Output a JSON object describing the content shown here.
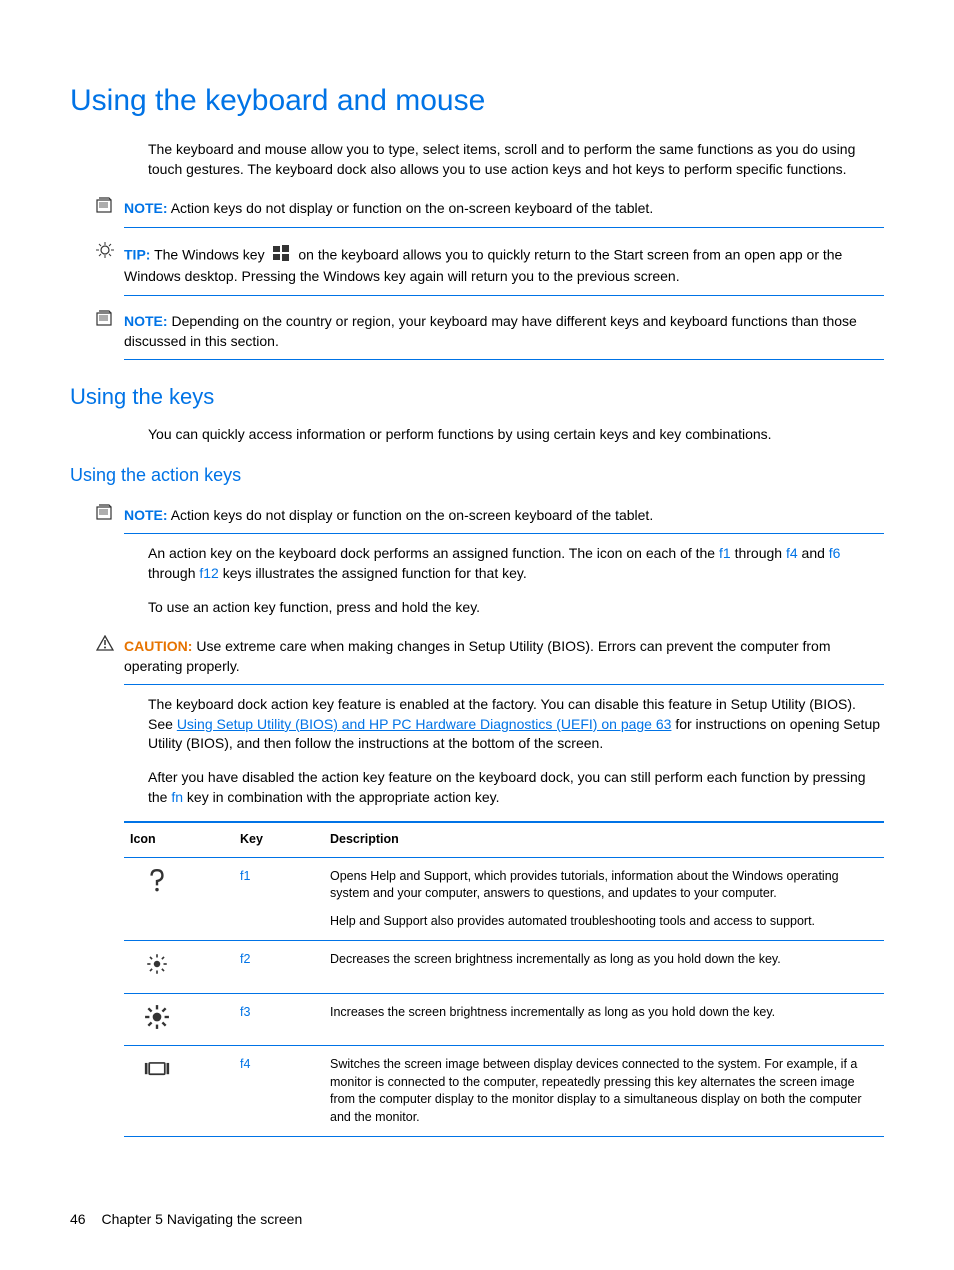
{
  "h1": "Using the keyboard and mouse",
  "intro": "The keyboard and mouse allow you to type, select items, scroll and to perform the same functions as you do using touch gestures. The keyboard dock also allows you to use action keys and hot keys to perform specific functions.",
  "note1_label": "NOTE:",
  "note1_text": "Action keys do not display or function on the on-screen keyboard of the tablet.",
  "tip_label": "TIP:",
  "tip_text_before": "The Windows key",
  "tip_text_after": "on the keyboard allows you to quickly return to the Start screen from an open app or the Windows desktop. Pressing the Windows key again will return you to the previous screen.",
  "note2_label": "NOTE:",
  "note2_text": "Depending on the country or region, your keyboard may have different keys and keyboard functions than those discussed in this section.",
  "h2": "Using the keys",
  "keys_intro": "You can quickly access information or perform functions by using certain keys and key combinations.",
  "h3": "Using the action keys",
  "note3_label": "NOTE:",
  "note3_text": "Action keys do not display or function on the on-screen keyboard of the tablet.",
  "action_p1_a": "An action key on the keyboard dock performs an assigned function. The icon on each of the ",
  "key_f1": "f1",
  "action_p1_b": " through ",
  "key_f4": "f4",
  "action_p1_c": " and ",
  "key_f6": "f6",
  "action_p1_d": " through ",
  "key_f12": "f12",
  "action_p1_e": " keys illustrates the assigned function for that key.",
  "action_p2": "To use an action key function, press and hold the key.",
  "caution_label": "CAUTION:",
  "caution_text": "Use extreme care when making changes in Setup Utility (BIOS). Errors can prevent the computer from operating properly.",
  "action_p3_a": "The keyboard dock action key feature is enabled at the factory. You can disable this feature in Setup Utility (BIOS). See ",
  "link_text": "Using Setup Utility (BIOS) and HP PC Hardware Diagnostics (UEFI) on page 63",
  "action_p3_b": " for instructions on opening Setup Utility (BIOS), and then follow the instructions at the bottom of the screen.",
  "action_p4_a": "After you have disabled the action key feature on the keyboard dock, you can still perform each function by pressing the ",
  "key_fn": "fn",
  "action_p4_b": " key in combination with the appropriate action key.",
  "table": {
    "headers": {
      "icon": "Icon",
      "key": "Key",
      "desc": "Description"
    },
    "rows": [
      {
        "key": "f1",
        "desc1": "Opens Help and Support, which provides tutorials, information about the Windows operating system and your computer, answers to questions, and updates to your computer.",
        "desc2": "Help and Support also provides automated troubleshooting tools and access to support."
      },
      {
        "key": "f2",
        "desc1": "Decreases the screen brightness incrementally as long as you hold down the key."
      },
      {
        "key": "f3",
        "desc1": "Increases the screen brightness incrementally as long as you hold down the key."
      },
      {
        "key": "f4",
        "desc1": "Switches the screen image between display devices connected to the system. For example, if a monitor is connected to the computer, repeatedly pressing this key alternates the screen image from the computer display to the monitor display to a simultaneous display on both the computer and the monitor."
      }
    ]
  },
  "footer": {
    "page": "46",
    "chapter": "Chapter 5   Navigating the screen"
  }
}
